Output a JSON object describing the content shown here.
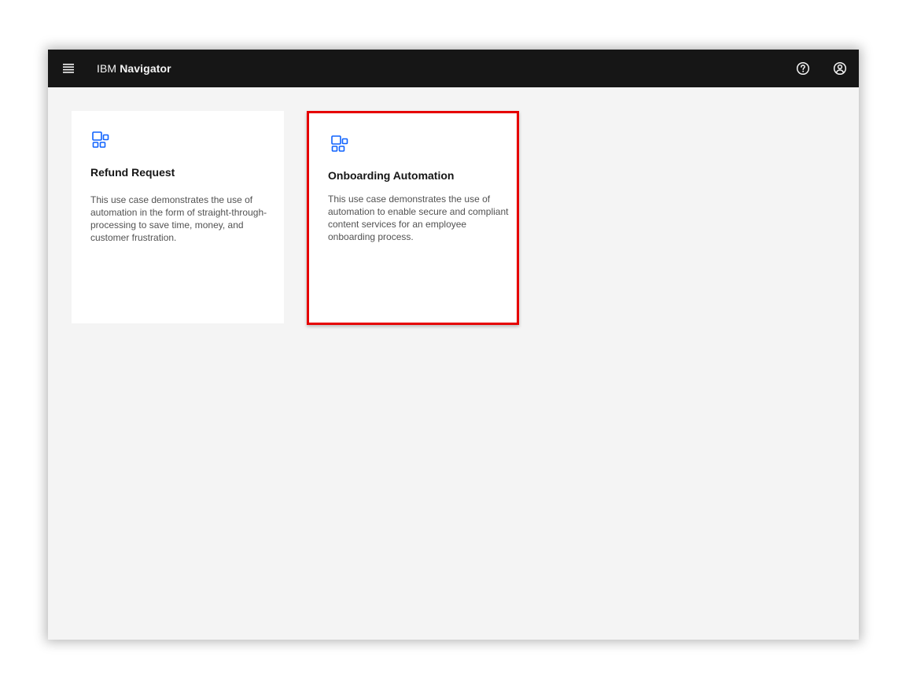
{
  "app": {
    "brand_prefix": "IBM",
    "brand_name": "Navigator"
  },
  "header": {
    "icons": [
      "menu-icon",
      "help-icon",
      "user-avatar-icon"
    ]
  },
  "cards": [
    {
      "title": "Refund Request",
      "description": "This use case demonstrates the use of automation in the form of straight-through-processing to save time, money, and customer frustration.",
      "icon": "apps-icon"
    },
    {
      "title": "Onboarding Automation",
      "description": "This use case demonstrates the use of automation to enable secure and compliant content services for an employee onboarding process.",
      "icon": "apps-icon",
      "highlighted": true
    }
  ],
  "colors": {
    "header_bg": "#161616",
    "page_bg": "#f4f4f4",
    "card_bg": "#ffffff",
    "icon_accent": "#0f62fe",
    "highlight_border": "#e60000"
  }
}
